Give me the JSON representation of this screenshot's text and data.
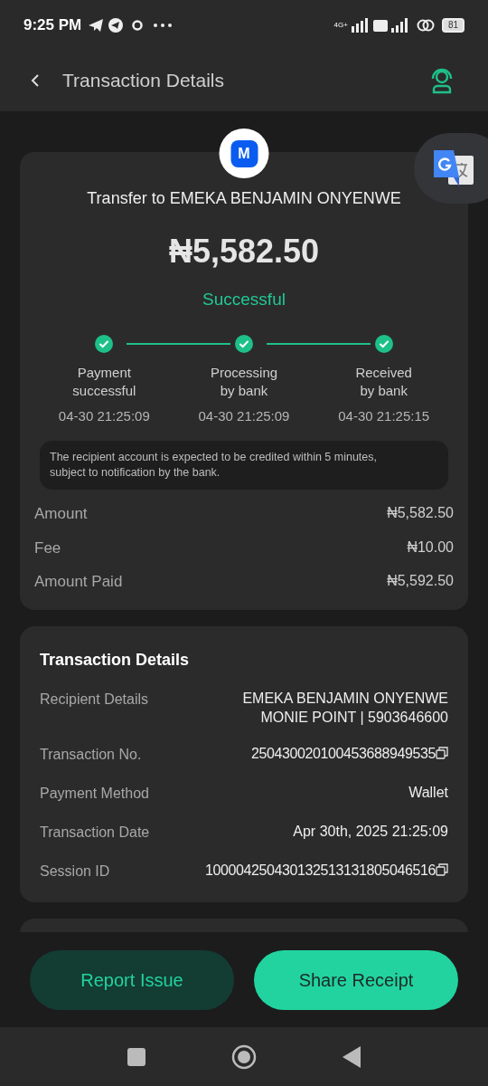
{
  "status_bar": {
    "time": "9:25 PM",
    "network": "4G+",
    "battery": "81"
  },
  "header": {
    "title": "Transaction Details"
  },
  "summary": {
    "logo_letter": "M",
    "title": "Transfer to EMEKA BENJAMIN ONYENWE",
    "amount": "₦5,582.50",
    "status": "Successful",
    "steps": [
      {
        "label": "Payment\nsuccessful",
        "time": "04-30 21:25:09",
        "done": true
      },
      {
        "label": "Processing\nby bank",
        "time": "04-30 21:25:09",
        "done": true
      },
      {
        "label": "Received\nby bank",
        "time": "04-30 21:25:15",
        "done": true
      }
    ],
    "note": "The recipient account is expected to be credited within 5 minutes, subject to notification by the bank.",
    "rows": [
      {
        "label": "Amount",
        "value": "₦5,582.50"
      },
      {
        "label": "Fee",
        "value": "₦10.00"
      },
      {
        "label": "Amount Paid",
        "value": "₦5,592.50"
      }
    ]
  },
  "details": {
    "title": "Transaction Details",
    "rows": [
      {
        "label": "Recipient Details",
        "value": "EMEKA BENJAMIN ONYENWE\nMONIE POINT | 5903646600",
        "copyable": false
      },
      {
        "label": "Transaction No.",
        "value": "250430020100453688949535",
        "copyable": true
      },
      {
        "label": "Payment Method",
        "value": "Wallet",
        "copyable": false
      },
      {
        "label": "Transaction Date",
        "value": "Apr 30th, 2025 21:25:09",
        "copyable": false
      },
      {
        "label": "Session ID",
        "value": "100004250430132513131805046516",
        "copyable": true
      }
    ]
  },
  "buttons": [
    {
      "label": "Report Issue",
      "kind": "secondary"
    },
    {
      "label": "Share Receipt",
      "kind": "primary"
    }
  ]
}
